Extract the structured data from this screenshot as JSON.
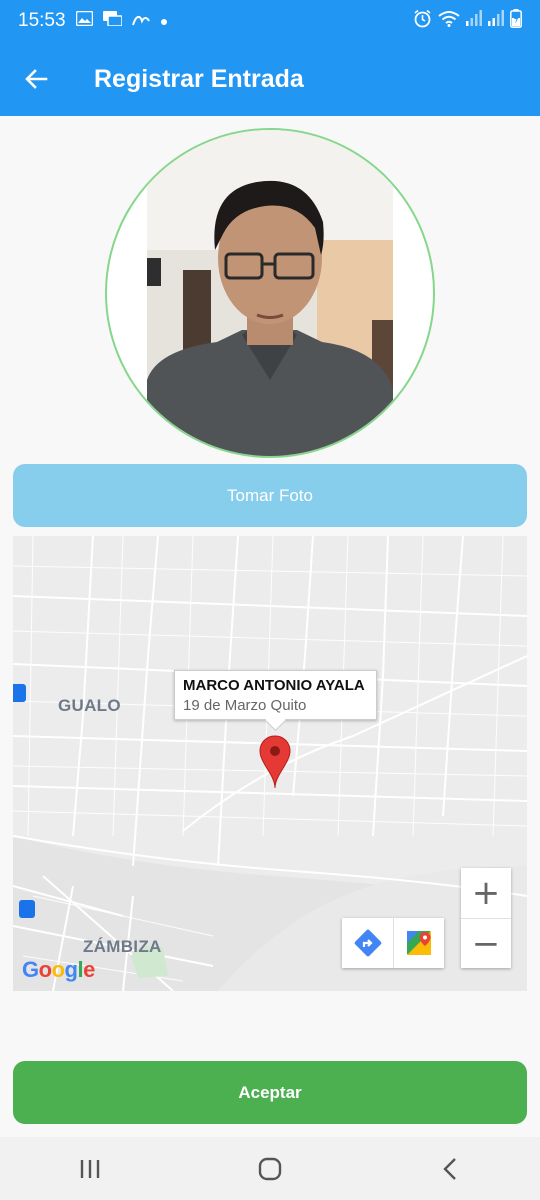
{
  "status_bar": {
    "time": "15:53",
    "left_icons": [
      "image-icon",
      "messages-icon",
      "wave-icon",
      "dot-icon"
    ],
    "right_icons": [
      "alarm-icon",
      "wifi-icon",
      "signal-icon",
      "signal-icon",
      "battery-charging-icon"
    ]
  },
  "app_bar": {
    "title": "Registrar Entrada",
    "back_icon": "arrow-left-icon"
  },
  "buttons": {
    "take_photo": "Tomar Foto",
    "accept": "Aceptar"
  },
  "map": {
    "districts": [
      "GUALO",
      "ZÁMBIZA"
    ],
    "info_window": {
      "title": "MARCO ANTONIO AYALA",
      "subtitle": "19 de Marzo Quito"
    },
    "zoom_in": "+",
    "zoom_out": "−",
    "google_logo": "Google",
    "colors": {
      "background": "#ececec",
      "roads": "#ffffff",
      "marker": "#e53935"
    }
  },
  "nav_bar": {
    "icons": [
      "recent-apps-icon",
      "home-icon",
      "back-icon"
    ]
  },
  "colors": {
    "primary": "#2196f3",
    "take_photo_button": "#87cdec",
    "accept_button": "#4caf50",
    "photo_ring": "#86d78b"
  }
}
